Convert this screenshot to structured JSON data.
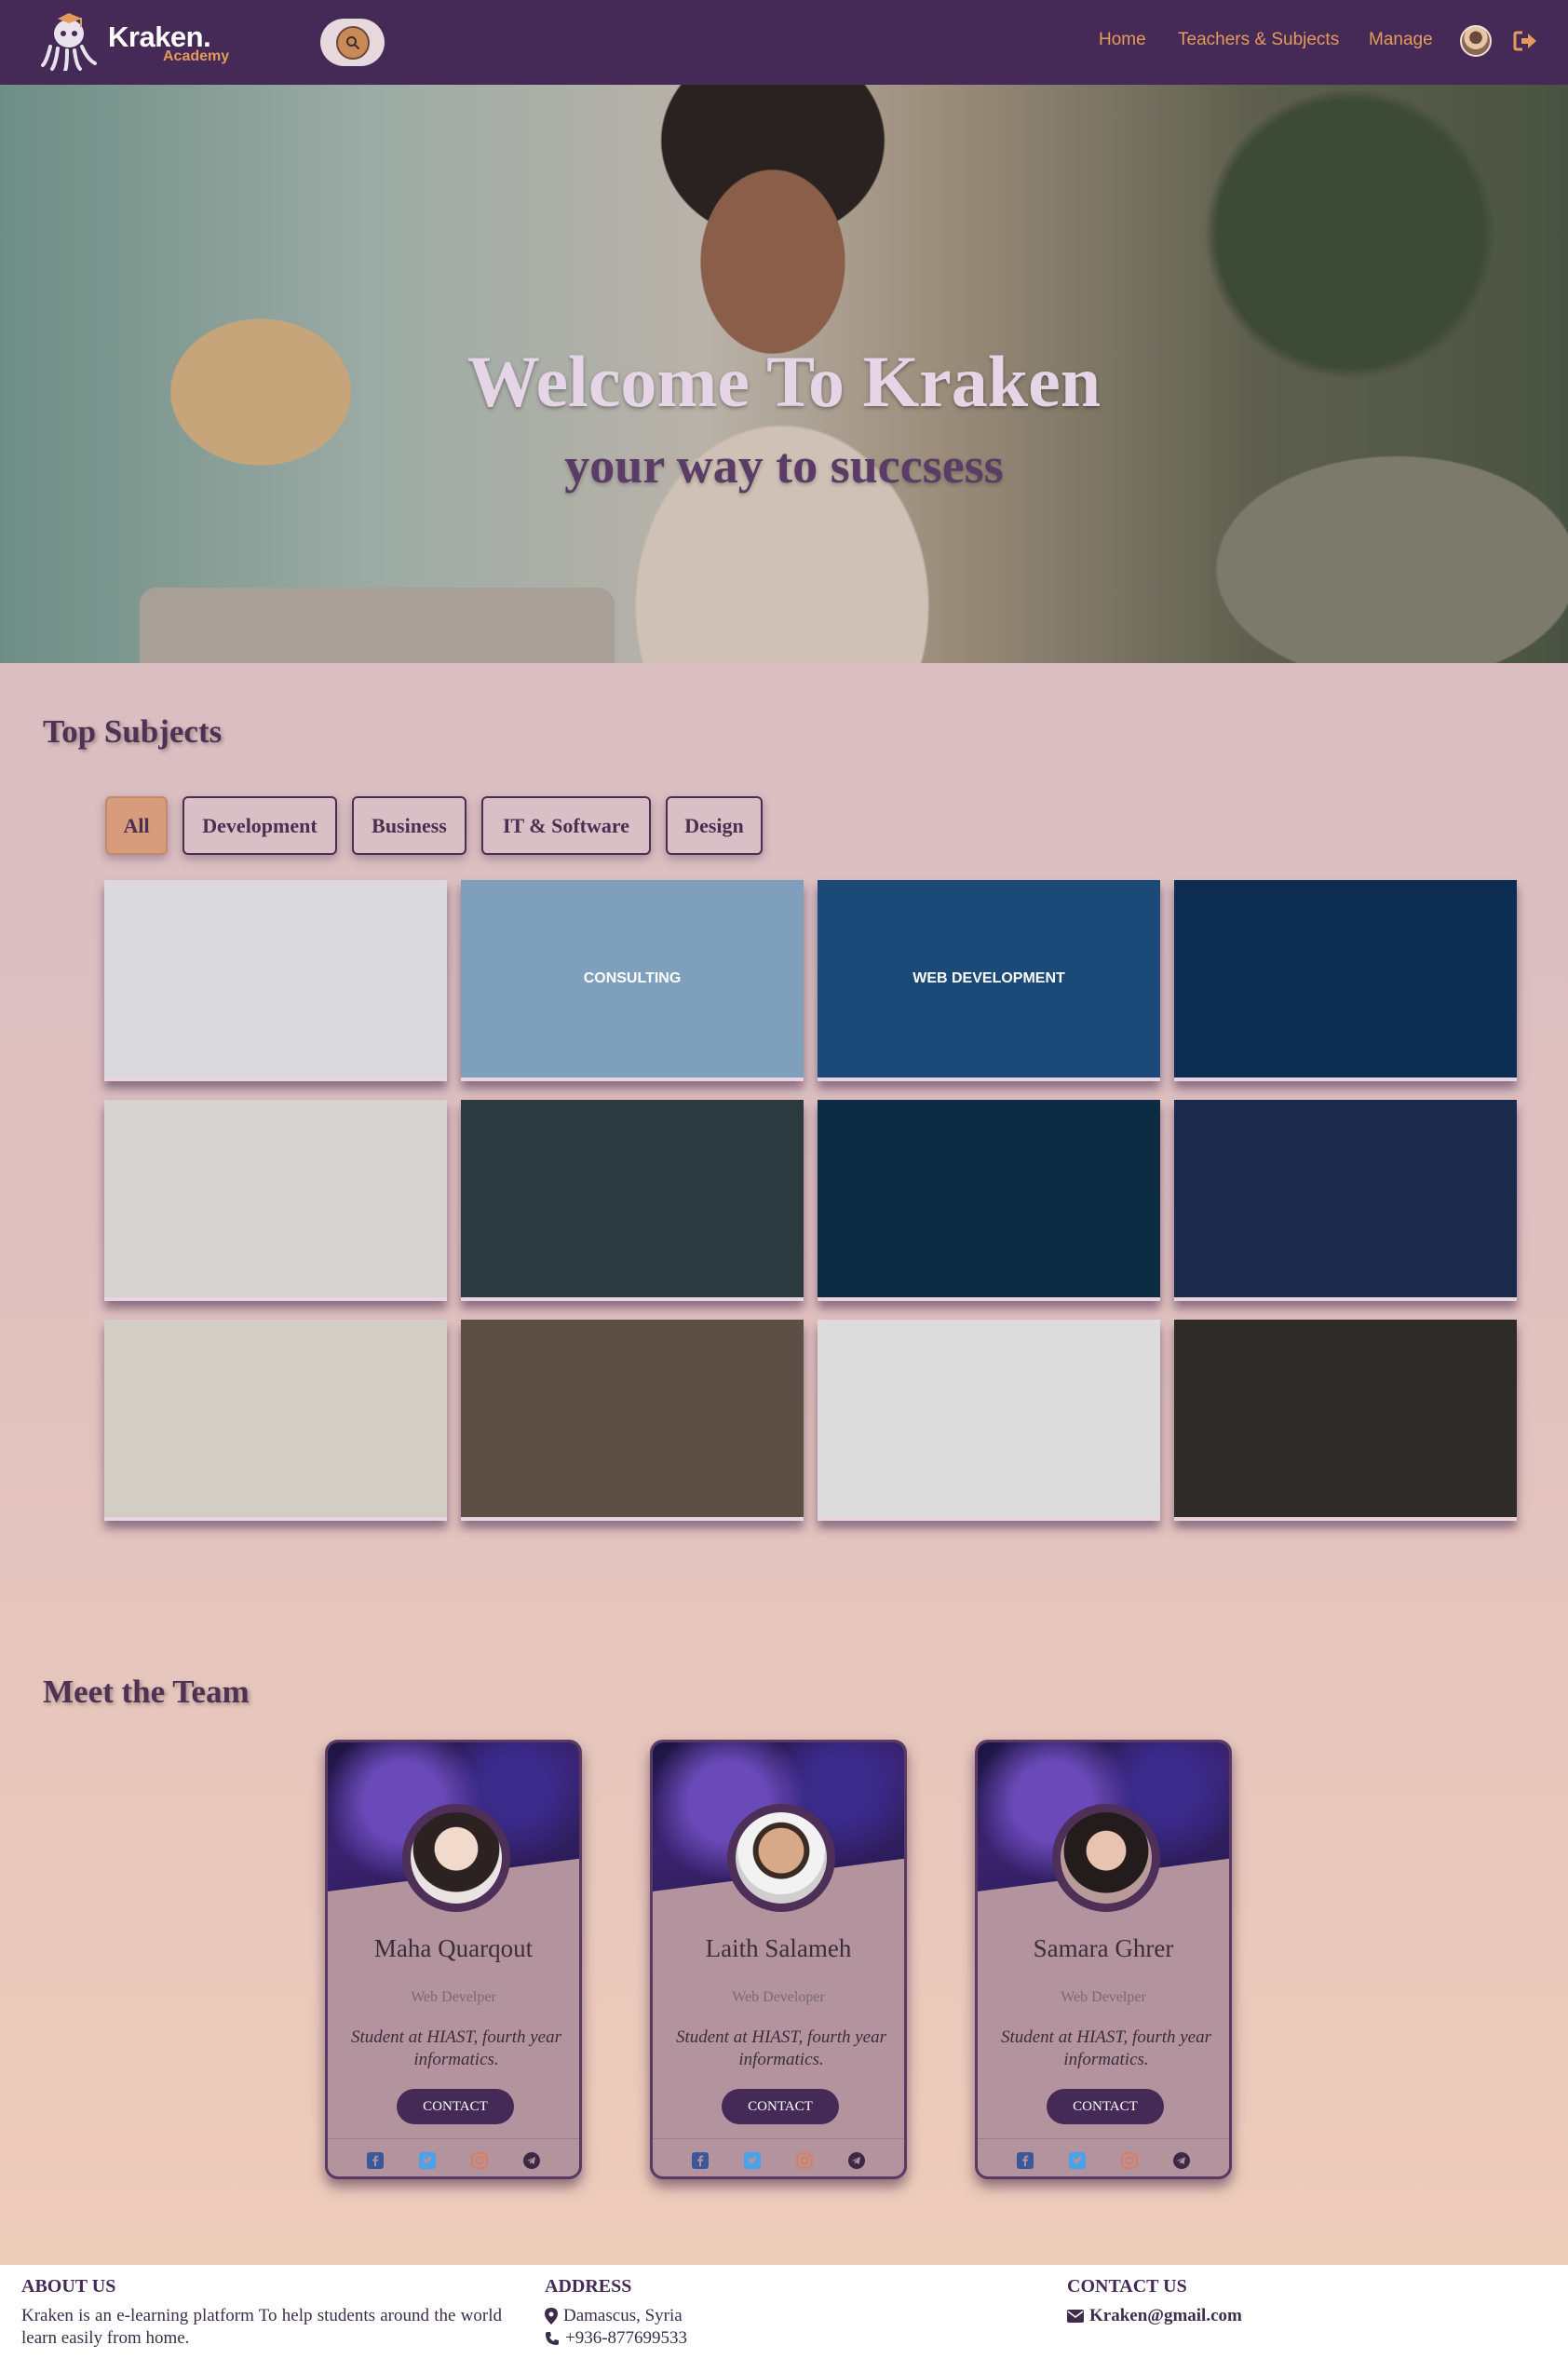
{
  "brand": {
    "title": "Kraken.",
    "subtitle": "Academy"
  },
  "nav": {
    "home": "Home",
    "teachers": "Teachers & Subjects",
    "manage": "Manage"
  },
  "hero": {
    "title": "Welcome To Kraken",
    "subtitle": "your way to succsess"
  },
  "subjects": {
    "title": "Top Subjects",
    "filters": [
      "All",
      "Development",
      "Business",
      "IT & Software",
      "Design"
    ],
    "active_filter": "All",
    "tiles": [
      {
        "label": "",
        "bg": "#d9d9de"
      },
      {
        "label": "CONSULTING",
        "bg": "#7fa0bd"
      },
      {
        "label": "WEB DEVELOPMENT",
        "bg": "#1b4a78"
      },
      {
        "label": "",
        "bg": "#0d2d52"
      },
      {
        "label": "",
        "bg": "#d7d3d0"
      },
      {
        "label": "",
        "bg": "#2c3a40"
      },
      {
        "label": "",
        "bg": "#0d2c44"
      },
      {
        "label": "",
        "bg": "#1b2a4a"
      },
      {
        "label": "",
        "bg": "#d4cdc6"
      },
      {
        "label": "",
        "bg": "#5c5046"
      },
      {
        "label": "",
        "bg": "#dcdcdc"
      },
      {
        "label": "",
        "bg": "#2f2b29"
      }
    ]
  },
  "team": {
    "title": "Meet the Team",
    "members": [
      {
        "name": "Maha Quarqout",
        "role": "Web Develper",
        "desc": "Student at HIAST, fourth year informatics.",
        "contact": "CONTACT"
      },
      {
        "name": "Laith Salameh",
        "role": "Web Developer",
        "desc": "Student at HIAST, fourth year informatics.",
        "contact": "CONTACT"
      },
      {
        "name": "Samara Ghrer",
        "role": "Web Develper",
        "desc": "Student at HIAST, fourth year informatics.",
        "contact": "CONTACT"
      }
    ]
  },
  "footer": {
    "about_title": "ABOUT US",
    "about_text": "Kraken is an e-learning platform To help students around the world learn easily from home.",
    "address_title": "ADDRESS",
    "address_city": "Damascus, Syria",
    "address_phone": "+936-877699533",
    "contact_title": "CONTACT US",
    "contact_email": "Kraken@gmail.com"
  },
  "colors": {
    "nav_bg": "#452a58",
    "accent": "#e39a5a",
    "title": "#4f3253"
  }
}
